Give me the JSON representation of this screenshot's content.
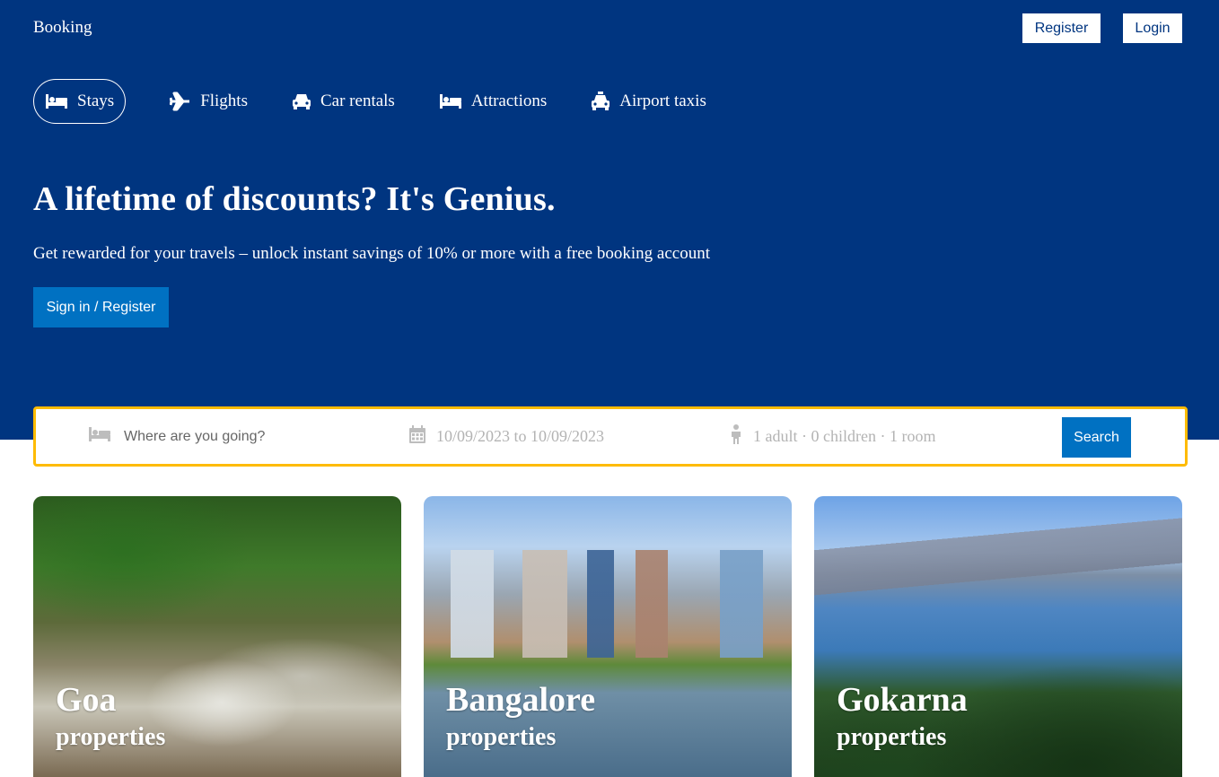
{
  "header": {
    "logo": "Booking",
    "register_label": "Register",
    "login_label": "Login"
  },
  "nav": {
    "items": [
      {
        "label": "Stays",
        "icon": "bed-icon",
        "active": true
      },
      {
        "label": "Flights",
        "icon": "plane-icon"
      },
      {
        "label": "Car rentals",
        "icon": "car-icon"
      },
      {
        "label": "Attractions",
        "icon": "bed-icon"
      },
      {
        "label": "Airport taxis",
        "icon": "taxi-icon"
      }
    ]
  },
  "hero": {
    "title": "A lifetime of discounts? It's Genius.",
    "subtitle": "Get rewarded for your travels – unlock instant savings of 10% or more with a free booking account",
    "signin_label": "Sign in / Register"
  },
  "search": {
    "destination_placeholder": "Where are you going?",
    "destination_value": "",
    "dates": "10/09/2023 to 10/09/2023",
    "guests": "1 adult · 0 children · 1 room",
    "button_label": "Search",
    "border_color": "#febb02"
  },
  "cards": [
    {
      "city": "Goa",
      "subtitle": "properties"
    },
    {
      "city": "Bangalore",
      "subtitle": "properties"
    },
    {
      "city": "Gokarna",
      "subtitle": "properties"
    }
  ],
  "colors": {
    "header_bg": "#003580",
    "accent_button": "#0071c2"
  }
}
